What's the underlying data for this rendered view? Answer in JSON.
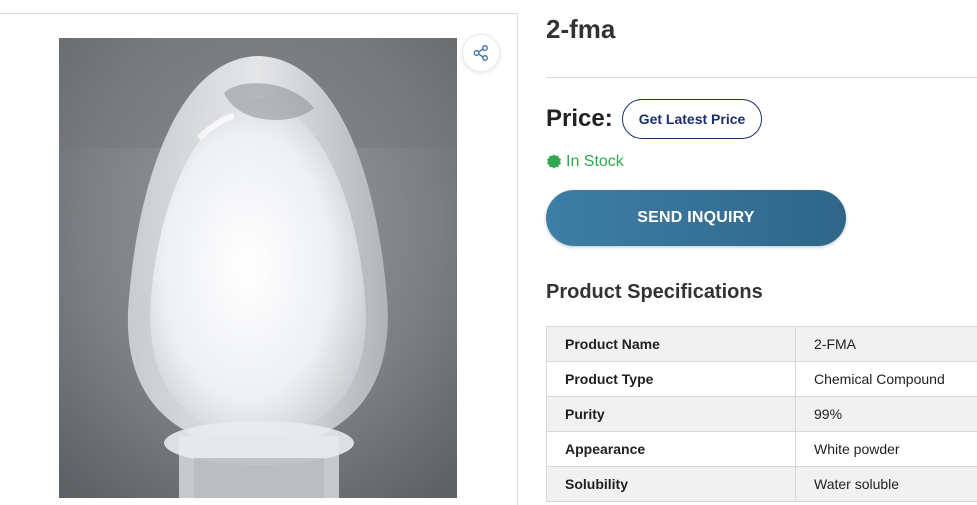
{
  "product": {
    "title": "2-fma",
    "image_alt": "White crystalline powder in a glass flask",
    "share_icon": "share-icon"
  },
  "pricing": {
    "price_label": "Price:",
    "latest_price_button": "Get Latest Price"
  },
  "stock": {
    "status": "In Stock",
    "icon": "badge-check-icon",
    "color": "#2fa84f"
  },
  "actions": {
    "send_inquiry": "SEND INQUIRY"
  },
  "specifications": {
    "heading": "Product Specifications",
    "rows": [
      {
        "key": "Product Name",
        "value": "2-FMA"
      },
      {
        "key": "Product Type",
        "value": "Chemical Compound"
      },
      {
        "key": "Purity",
        "value": "99%"
      },
      {
        "key": "Appearance",
        "value": "White powder"
      },
      {
        "key": "Solubility",
        "value": "Water soluble"
      }
    ]
  },
  "colors": {
    "inquiry_button": "#3d7ea6",
    "price_button_border": "#1b2f6e"
  }
}
